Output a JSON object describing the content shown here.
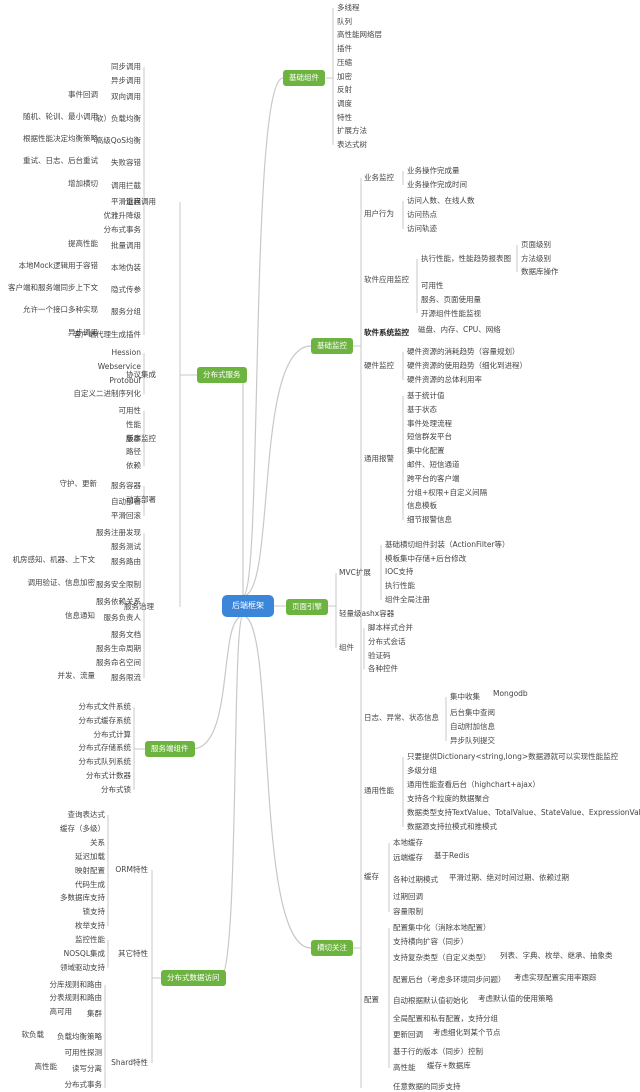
{
  "colors": {
    "root": "#3b86d8",
    "branch": "#6db33f",
    "line": "#c8c8c8",
    "text": "#444444"
  },
  "root": {
    "label": "后端框架"
  },
  "branches": {
    "basic_components": {
      "label": "基础组件",
      "items": [
        "多线程",
        "队列",
        "高性能网络层",
        "插件",
        "压缩",
        "加密",
        "反射",
        "调度",
        "特性",
        "扩展方法",
        "表达式树"
      ]
    },
    "basic_monitoring": {
      "label": "基础监控",
      "business": {
        "label": "业务监控",
        "items": [
          "业务操作完成量",
          "业务操作完成时间"
        ]
      },
      "user_behavior": {
        "label": "用户行为",
        "items": [
          "访问人数、在线人数",
          "访问热点",
          "访问轨迹"
        ]
      },
      "app_monitor": {
        "label": "软件应用监控",
        "perf": {
          "label": "执行性能，性能趋势报表图",
          "items": [
            "页面级别",
            "方法级别",
            "数据库操作"
          ]
        },
        "items": [
          "可用性",
          "服务、页面使用量",
          "开源组件性能监视"
        ]
      },
      "system_monitor": {
        "label": "软件系统监控",
        "items": [
          "磁盘、内存、CPU、网络"
        ]
      },
      "hardware_monitor": {
        "label": "硬件监控",
        "items": [
          "硬件资源的消耗趋势（容量规划）",
          "硬件资源的使用趋势（细化到进程）",
          "硬件资源的总体利用率"
        ]
      },
      "alerts": {
        "label": "通用报警",
        "items": [
          "基于统计值",
          "基于状态",
          "事件处理流程",
          "短信群发平台",
          "集中化配置",
          "邮件、短信通道",
          "跨平台的客户端",
          "分组+权限+自定义间隔",
          "信息模板",
          "细节报警信息"
        ]
      }
    },
    "page_engine": {
      "label": "页面引擎",
      "mvc": {
        "label": "MVC扩展",
        "items": [
          "基础横切组件封装（ActionFilter等）",
          "模板集中存储+后台修改",
          "IOC支持",
          "执行性能",
          "组件全局注册"
        ]
      },
      "ashx": {
        "label": "轻量级ashx容器"
      },
      "components": {
        "label": "组件",
        "items": [
          "脚本样式合并",
          "分布式会话",
          "验证码",
          "各种控件"
        ]
      }
    },
    "cross_cutting": {
      "label": "横切关注",
      "logging": {
        "label": "日志、异常、状态信息",
        "items": [
          {
            "label": "集中收集",
            "note": "Mongodb"
          },
          {
            "label": "后台集中查阅"
          },
          {
            "label": "自动附加信息"
          },
          {
            "label": "异步队列提交"
          }
        ]
      },
      "perf": {
        "label": "通用性能",
        "items": [
          "只要提供Dictionary<string,long>数据源就可以实现性能监控",
          "多级分组",
          "通用性能查看后台（highchart+ajax）",
          "支持各个粒度的数据聚合",
          "数据类型支持TextValue、TotalValue、StateValue、ExpressionValue",
          "数据源支持拉模式和推模式"
        ]
      },
      "cache": {
        "label": "缓存",
        "items": [
          {
            "label": "本地缓存"
          },
          {
            "label": "远端缓存",
            "note": "基于Redis"
          },
          {
            "label": "各种过期模式",
            "note": "平滑过期、绝对时间过期、依赖过期"
          },
          {
            "label": "过期回调"
          },
          {
            "label": "容量限制"
          }
        ]
      },
      "config": {
        "label": "配置",
        "items": [
          {
            "label": "配置集中化（消除本地配置）"
          },
          {
            "label": "支持横向扩容（同步）"
          },
          {
            "label": "支持复杂类型（自定义类型）",
            "note": "列表、字典、枚举、继承、抽象类"
          },
          {
            "label": "配置后台（考虑多环境同步问题）",
            "note": "考虑实现配置实用率跟踪"
          },
          {
            "label": "自动根据默认值初始化",
            "note": "考虑默认值的使用策略"
          },
          {
            "label": "全局配置和私有配置，支持分组"
          },
          {
            "label": "更新回调",
            "note": "考虑细化到某个节点"
          },
          {
            "label": "基于行的版本（同步）控制"
          },
          {
            "label": "高性能",
            "note": "缓存+数据库"
          }
        ]
      },
      "partial": "任意数据的同步支持"
    },
    "distributed_service": {
      "label": "分布式服务",
      "rpc": {
        "label": "远程调用",
        "items": [
          {
            "label": "同步调用"
          },
          {
            "label": "异步调用"
          },
          {
            "label": "双向调用",
            "note": "事件回调"
          },
          {
            "label": "（软）负载均衡",
            "note": "随机、轮训、最小调用"
          },
          {
            "label": "高级QoS均衡",
            "note": "根据性能决定均衡策略"
          },
          {
            "label": "失败容错",
            "note": "重试、日志、后台重试"
          },
          {
            "label": "调用拦截",
            "note": "增加横切"
          },
          {
            "label": "平滑重启"
          },
          {
            "label": "优雅升降级"
          },
          {
            "label": "分布式事务"
          },
          {
            "label": "批量调用",
            "note": "提高性能"
          },
          {
            "label": "本地伪装",
            "note": "本地Mock逻辑用于容错"
          },
          {
            "label": "隐式传参",
            "note": "客户端和服务端同步上下文"
          },
          {
            "label": "服务分组",
            "note": "允许一个接口多种实现"
          },
          {
            "label": "客户端代理生成插件",
            "note": "异步调用"
          }
        ]
      },
      "protocol": {
        "label": "协议集成",
        "items": [
          "Hession",
          "Webservice",
          "Protobuf",
          "自定义二进制序列化"
        ]
      },
      "cluster": {
        "label": "集群监控",
        "items": [
          "可用性",
          "性能",
          "版本",
          "路径",
          "依赖"
        ]
      },
      "deploy": {
        "label": "动态部署",
        "items": [
          {
            "label": "服务容器",
            "note": "守护、更新"
          },
          {
            "label": "自动部署"
          },
          {
            "label": "平滑回滚"
          }
        ]
      },
      "governance": {
        "label": "服务治理",
        "items": [
          {
            "label": "服务注册发现"
          },
          {
            "label": "服务测试"
          },
          {
            "label": "服务路由",
            "note": "机房感知、机器、上下文"
          },
          {
            "label": "服务安全限制",
            "note": "调用验证、信息加密"
          },
          {
            "label": "服务依赖关系"
          },
          {
            "label": "服务负责人",
            "note": "信息通知"
          },
          {
            "label": "服务文档"
          },
          {
            "label": "服务生命周期"
          },
          {
            "label": "服务命名空间"
          },
          {
            "label": "服务限流",
            "note": "并发、流量"
          }
        ]
      }
    },
    "service_components": {
      "label": "服务端组件",
      "items": [
        "分布式文件系统",
        "分布式缓存系统",
        "分布式计算",
        "分布式存储系统",
        "分布式队列系统",
        "分布式计数器",
        "分布式锁"
      ]
    },
    "data_access": {
      "label": "分布式数据访问",
      "orm": {
        "label": "ORM特性",
        "items": [
          "查询表达式",
          "缓存（多级）",
          "关系",
          "延迟加载",
          "映射配置",
          "代码生成",
          "多数据库支持",
          "锁支持",
          "枚举支持"
        ]
      },
      "other": {
        "label": "其它特性",
        "items": [
          "监控性能",
          "NOSQL集成",
          "领域驱动支持"
        ]
      },
      "shard": {
        "label": "Shard特性",
        "items": [
          {
            "label": "分库规则和路由"
          },
          {
            "label": "分表规则和路由"
          },
          {
            "label": "集群",
            "note": "高可用"
          },
          {
            "label": "负载均衡策略",
            "note": "软负载"
          },
          {
            "label": "可用性探测"
          },
          {
            "label": "读写分离",
            "note": "高性能"
          },
          {
            "label": "分布式事务"
          }
        ]
      }
    }
  }
}
